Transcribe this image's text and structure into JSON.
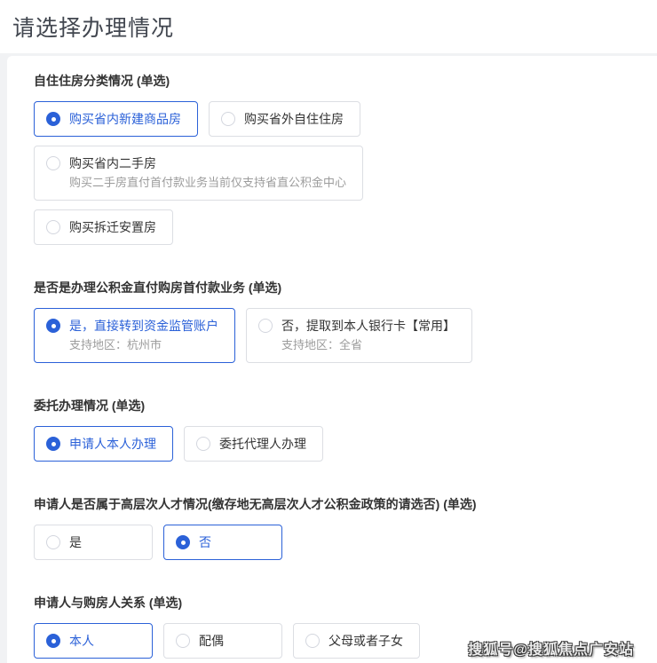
{
  "page": {
    "title": "请选择办理情况",
    "watermark": "搜狐号@搜狐焦点广安站"
  },
  "colors": {
    "accent": "#2b61d8",
    "border": "#dcdee3",
    "text": "#333333",
    "subtext": "#9c9c9c",
    "page_bg": "#f1f2f4"
  },
  "sections": [
    {
      "title": "自住住房分类情况 (单选)",
      "rows": [
        [
          {
            "label": "购买省内新建商品房",
            "selected": true
          },
          {
            "label": "购买省外自住住房",
            "selected": false
          }
        ],
        [
          {
            "label": "购买省内二手房",
            "sub": "购买二手房直付首付款业务当前仅支持省直公积金中心",
            "selected": false
          }
        ],
        [
          {
            "label": "购买拆迁安置房",
            "selected": false
          }
        ]
      ]
    },
    {
      "title": "是否是办理公积金直付购房首付款业务 (单选)",
      "rows": [
        [
          {
            "label": "是，直接转到资金监管账户",
            "sub": "支持地区：杭州市",
            "selected": true
          },
          {
            "label": "否，提取到本人银行卡【常用】",
            "sub": "支持地区：全省",
            "selected": false
          }
        ]
      ]
    },
    {
      "title": "委托办理情况 (单选)",
      "rows": [
        [
          {
            "label": "申请人本人办理",
            "selected": true
          },
          {
            "label": "委托代理人办理",
            "selected": false
          }
        ]
      ]
    },
    {
      "title": "申请人是否属于高层次人才情况(缴存地无高层次人才公积金政策的请选否) (单选)",
      "rows": [
        [
          {
            "label": "是",
            "selected": false
          },
          {
            "label": "否",
            "selected": true
          }
        ]
      ]
    },
    {
      "title": "申请人与购房人关系 (单选)",
      "rows": [
        [
          {
            "label": "本人",
            "selected": true
          },
          {
            "label": "配偶",
            "selected": false
          },
          {
            "label": "父母或者子女",
            "selected": false
          }
        ]
      ]
    }
  ]
}
